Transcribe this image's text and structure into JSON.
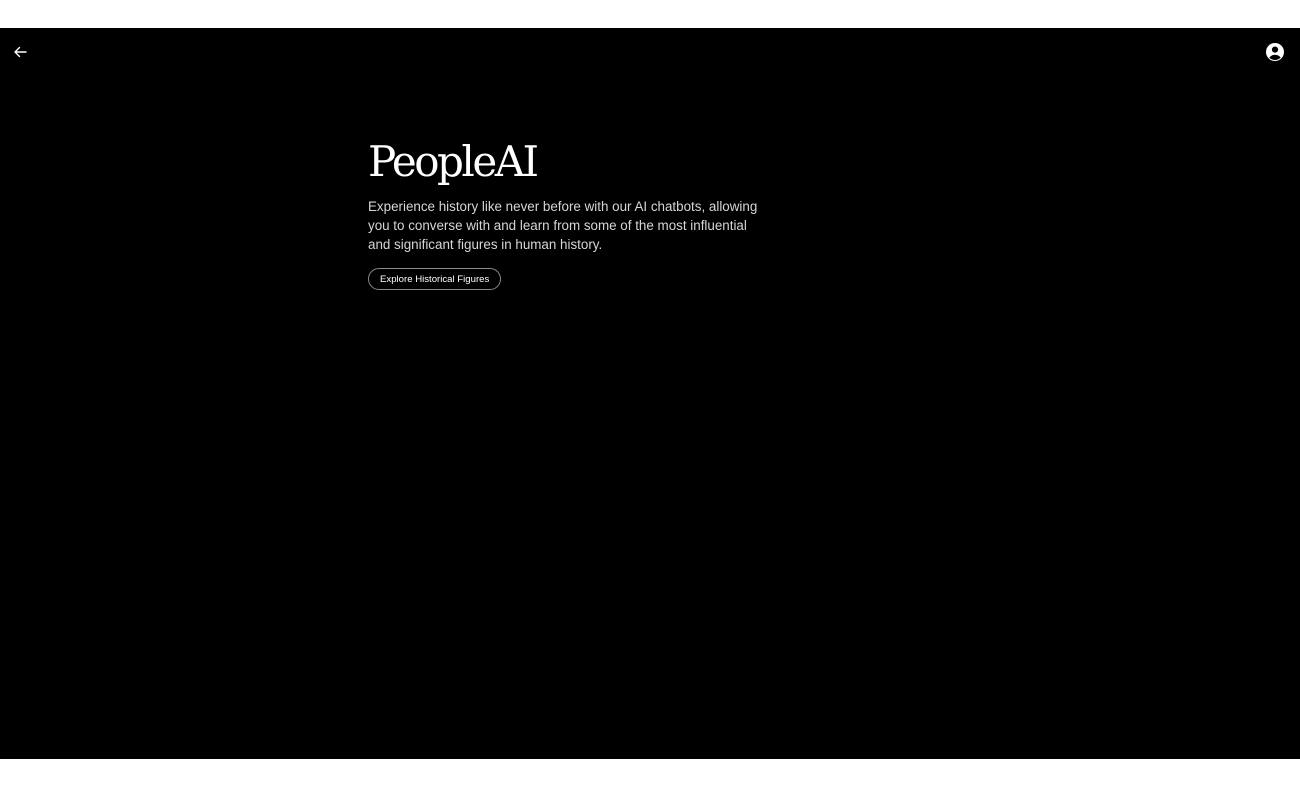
{
  "header": {
    "back_icon": "arrow-left-icon",
    "account_icon": "account-circle-icon"
  },
  "hero": {
    "title": "PeopleAI",
    "description": "Experience history like never before with our AI chatbots, allowing you to converse with and learn from some of the most influential and significant figures in human history.",
    "cta_label": "Explore Historical Figures"
  },
  "colors": {
    "background": "#000000",
    "text": "#ffffff",
    "muted_text": "#d6d6d6",
    "button_border": "#8a8a8a"
  }
}
